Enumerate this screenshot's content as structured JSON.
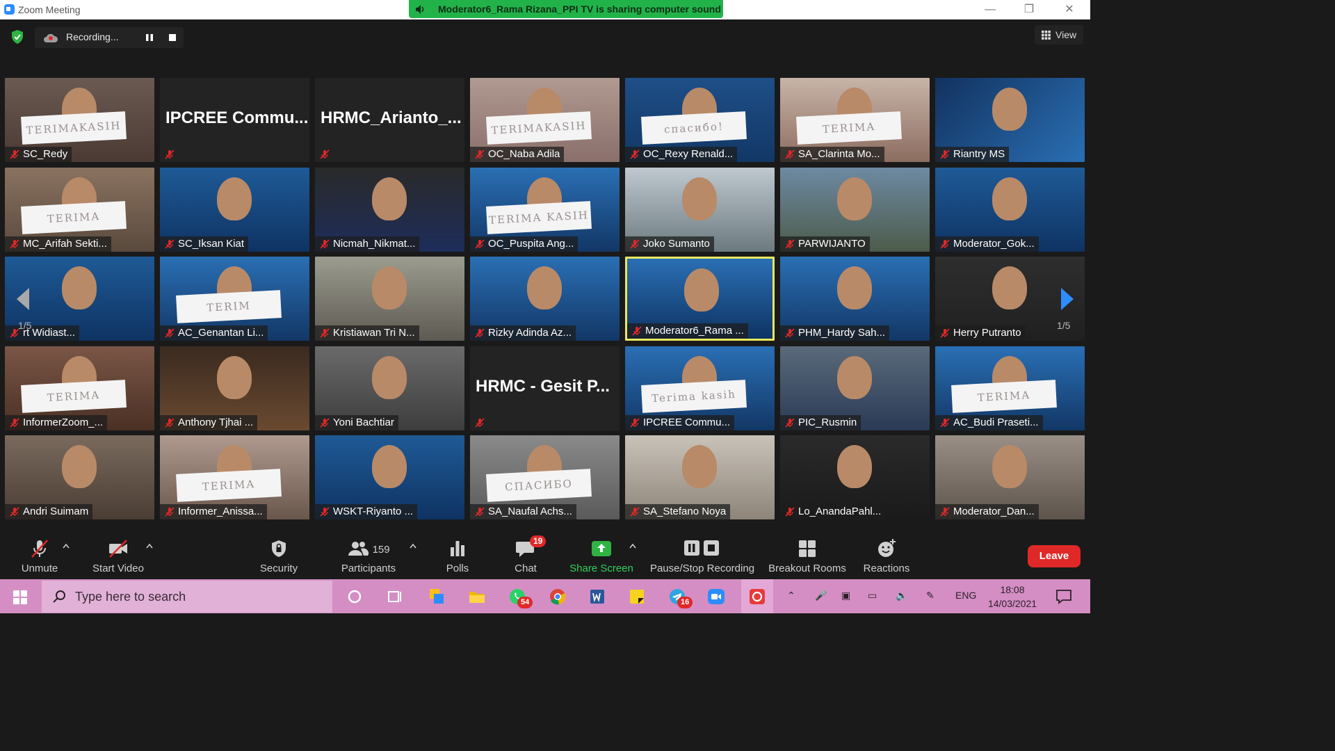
{
  "window": {
    "title": "Zoom Meeting",
    "share_banner": "Moderator6_Rama Rizana_PPI TV is sharing computer sound"
  },
  "recording": {
    "label": "Recording..."
  },
  "view_button": {
    "label": "View"
  },
  "pagination": {
    "left": "1/5",
    "right": "1/5"
  },
  "tiles": [
    {
      "name": "SC_Redy",
      "sign": "TERIMAKASIH"
    },
    {
      "name": "",
      "big_name": "IPCREE  Commu..."
    },
    {
      "name": "",
      "big_name": "HRMC_Arianto_..."
    },
    {
      "name": "OC_Naba Adila",
      "sign": "TERIMAKASIH"
    },
    {
      "name": "OC_Rexy Renald...",
      "sign": "спасибо!"
    },
    {
      "name": "SA_Clarinta Mo...",
      "sign": "TERIMA"
    },
    {
      "name": "Riantry MS"
    },
    {
      "name": "MC_Arifah Sekti...",
      "sign": "TERIMA"
    },
    {
      "name": "SC_Iksan Kiat"
    },
    {
      "name": "Nicmah_Nikmat..."
    },
    {
      "name": "OC_Puspita Ang...",
      "sign": "TERIMA KASIH"
    },
    {
      "name": "Joko Sumanto"
    },
    {
      "name": "PARWIJANTO"
    },
    {
      "name": "Moderator_Gok..."
    },
    {
      "name": "rt Widiast..."
    },
    {
      "name": "AC_Genantan Li...",
      "sign": "TERIM"
    },
    {
      "name": "Kristiawan Tri N..."
    },
    {
      "name": "Rizky Adinda Az..."
    },
    {
      "name": "Moderator6_Rama ..."
    },
    {
      "name": "PHM_Hardy Sah..."
    },
    {
      "name": "Herry Putranto"
    },
    {
      "name": "InformerZoom_...",
      "sign": "TERIMA"
    },
    {
      "name": "Anthony Tjhai ..."
    },
    {
      "name": "Yoni Bachtiar"
    },
    {
      "name": "",
      "big_name": "HRMC - Gesit P..."
    },
    {
      "name": "IPCREE Commu...",
      "sign": "Terima kasih"
    },
    {
      "name": "PIC_Rusmin"
    },
    {
      "name": "AC_Budi Praseti...",
      "sign": "TERIMA"
    },
    {
      "name": "Andri Suimam"
    },
    {
      "name": "Informer_Anissa...",
      "sign": "TERIMA"
    },
    {
      "name": "WSKT-Riyanto ..."
    },
    {
      "name": "SA_Naufal Achs...",
      "sign": "СПАСИБО"
    },
    {
      "name": "SA_Stefano Noya"
    },
    {
      "name": "Lo_AnandaPahl..."
    },
    {
      "name": "Moderator_Dan..."
    }
  ],
  "toolbar": {
    "unmute": "Unmute",
    "start_video": "Start Video",
    "security": "Security",
    "participants": "Participants",
    "participants_count": "159",
    "polls": "Polls",
    "chat": "Chat",
    "chat_badge": "19",
    "share_screen": "Share Screen",
    "pause_stop": "Pause/Stop Recording",
    "breakout": "Breakout Rooms",
    "reactions": "Reactions",
    "leave": "Leave"
  },
  "taskbar": {
    "search_placeholder": "Type here to search",
    "whatsapp_badge": "54",
    "telegram_badge": "16",
    "language": "ENG",
    "time": "18:08",
    "date": "14/03/2021"
  },
  "colors": {
    "share_green": "#21b34a",
    "zoom_blue": "#2d8cff",
    "active_speaker": "#e9e85c",
    "leave_red": "#e02828",
    "taskbar": "#d48ec4"
  }
}
